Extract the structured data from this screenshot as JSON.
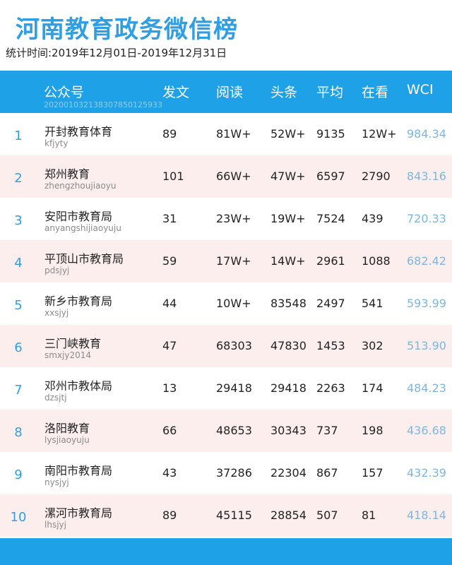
{
  "title": "河南教育政务微信榜",
  "period": "统计时间:2019年12月01日-2019年12月31日",
  "header": {
    "account": "公众号",
    "id_code": "20200103213830785012593​3",
    "posts": "发文",
    "reads": "阅读",
    "headline": "头条",
    "avg": "平均",
    "watching": "在看",
    "wci": "WCI"
  },
  "rows": [
    {
      "rank": "1",
      "name": "开封教育体育",
      "account": "kfjyty",
      "posts": "89",
      "reads": "81W+",
      "headline": "52W+",
      "avg": "9135",
      "watching": "12W+",
      "wci": "984.34"
    },
    {
      "rank": "2",
      "name": "郑州教育",
      "account": "zhengzhoujiaoyu",
      "posts": "101",
      "reads": "66W+",
      "headline": "47W+",
      "avg": "6597",
      "watching": "2790",
      "wci": "843.16"
    },
    {
      "rank": "3",
      "name": "安阳市教育局",
      "account": "anyangshijiaoyuju",
      "posts": "31",
      "reads": "23W+",
      "headline": "19W+",
      "avg": "7524",
      "watching": "439",
      "wci": "720.33"
    },
    {
      "rank": "4",
      "name": "平顶山市教育局",
      "account": "pdsjyj",
      "posts": "59",
      "reads": "17W+",
      "headline": "14W+",
      "avg": "2961",
      "watching": "1088",
      "wci": "682.42"
    },
    {
      "rank": "5",
      "name": "新乡市教育局",
      "account": "xxsjyj",
      "posts": "44",
      "reads": "10W+",
      "headline": "83548",
      "avg": "2497",
      "watching": "541",
      "wci": "593.99"
    },
    {
      "rank": "6",
      "name": "三门峡教育",
      "account": "smxjy2014",
      "posts": "47",
      "reads": "68303",
      "headline": "47830",
      "avg": "1453",
      "watching": "302",
      "wci": "513.90"
    },
    {
      "rank": "7",
      "name": "邓州市教体局",
      "account": "dzsjtj",
      "posts": "13",
      "reads": "29418",
      "headline": "29418",
      "avg": "2263",
      "watching": "174",
      "wci": "484.23"
    },
    {
      "rank": "8",
      "name": "洛阳教育",
      "account": "lysjiaoyuju",
      "posts": "66",
      "reads": "48653",
      "headline": "30343",
      "avg": "737",
      "watching": "198",
      "wci": "436.68"
    },
    {
      "rank": "9",
      "name": "南阳市教育局",
      "account": "nysjyj",
      "posts": "43",
      "reads": "37286",
      "headline": "22304",
      "avg": "867",
      "watching": "157",
      "wci": "432.39"
    },
    {
      "rank": "10",
      "name": "漯河市教育局",
      "account": "lhsjyj",
      "posts": "89",
      "reads": "45115",
      "headline": "28854",
      "avg": "507",
      "watching": "81",
      "wci": "418.14"
    }
  ]
}
